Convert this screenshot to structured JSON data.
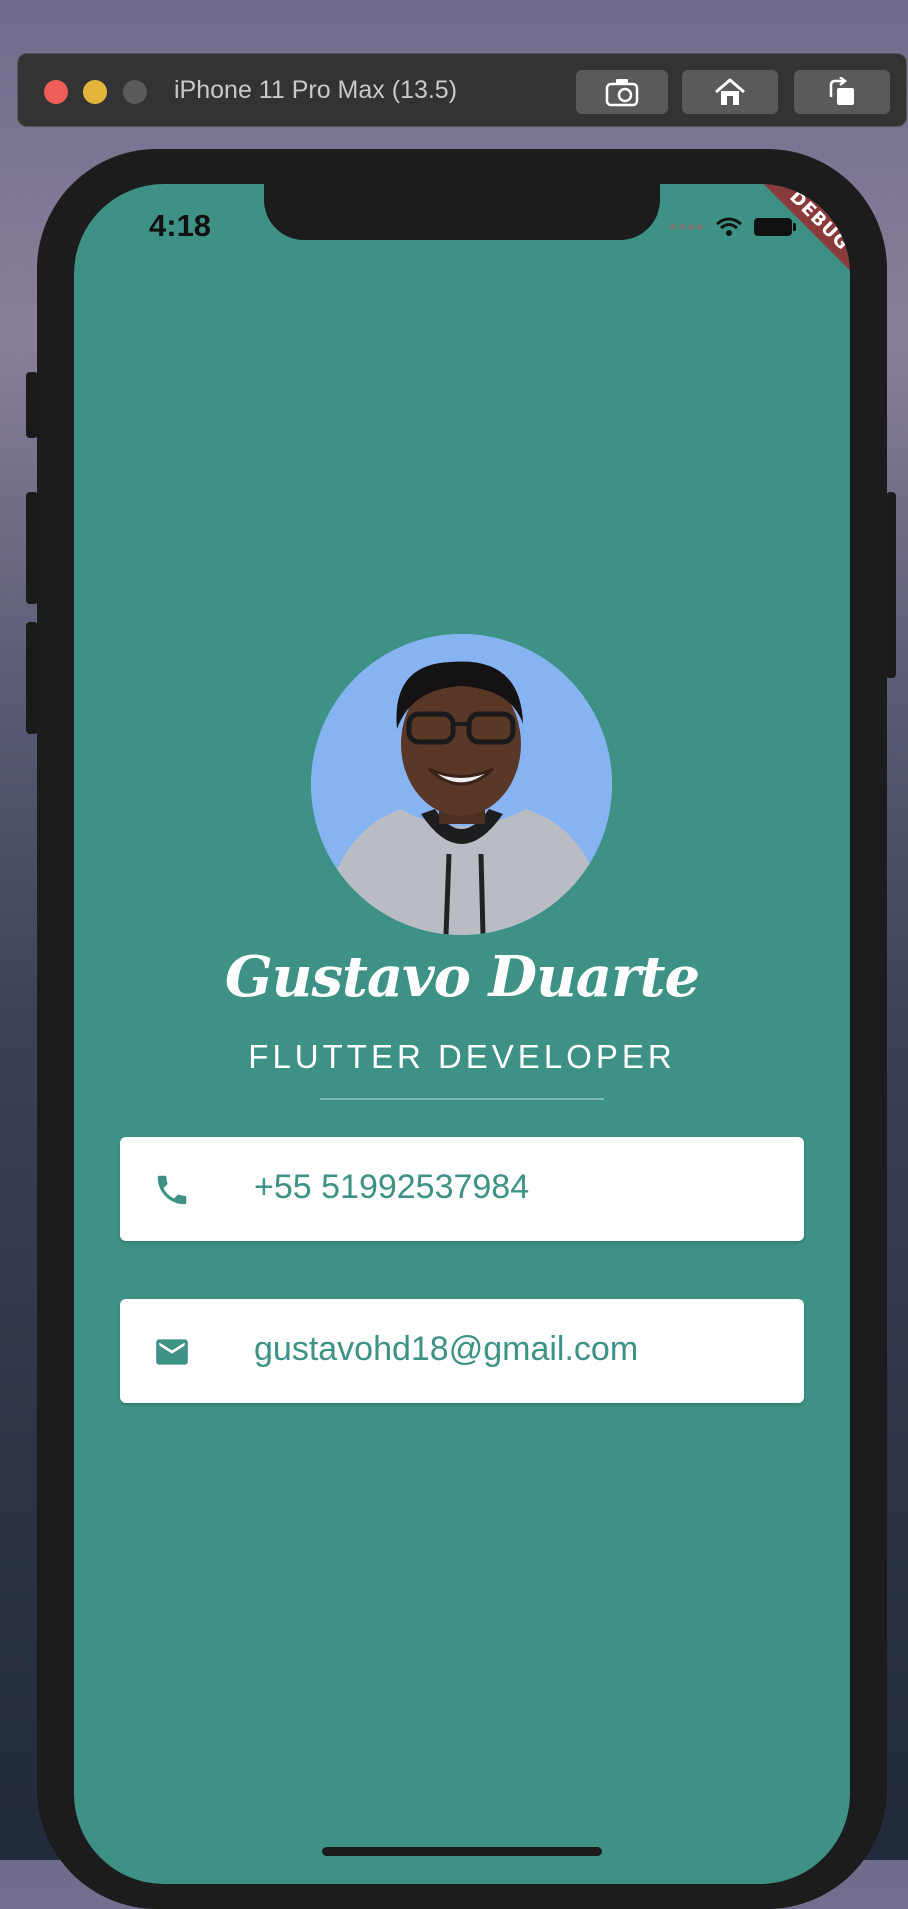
{
  "simulator": {
    "title": "iPhone 11 Pro Max (13.5)",
    "buttons": {
      "screenshot": "camera-icon",
      "home": "home-icon",
      "rotate": "rotate-icon"
    }
  },
  "status_bar": {
    "time": "4:18",
    "debug_label": "DEBUG"
  },
  "profile": {
    "name": "Gustavo Duarte",
    "title": "FLUTTER DEVELOPER",
    "phone": "+55 51992537984",
    "email": "gustavohd18@gmail.com"
  },
  "colors": {
    "background": "#3d9185",
    "accent": "#3d9185",
    "card": "#ffffff"
  }
}
